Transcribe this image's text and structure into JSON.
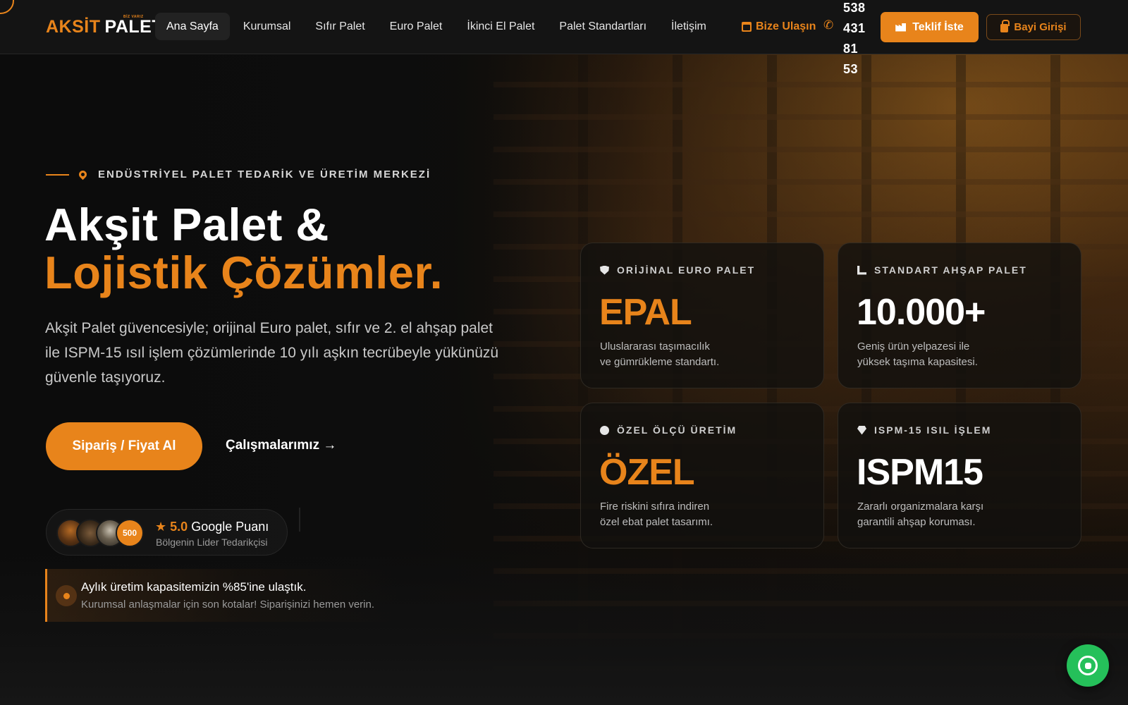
{
  "nav": {
    "logo_primary": "AKSİT",
    "logo_secondary": "PALET",
    "logo_tagline": "BİZ VARIZ",
    "links": [
      {
        "label": "Ana Sayfa",
        "active": true
      },
      {
        "label": "Kurumsal",
        "active": false
      },
      {
        "label": "Sıfır Palet",
        "active": false
      },
      {
        "label": "Euro Palet",
        "active": false
      },
      {
        "label": "İkinci El Palet",
        "active": false
      },
      {
        "label": "Palet Standartları",
        "active": false
      },
      {
        "label": "İletişim",
        "active": false
      }
    ],
    "contact_label": "Bize Ulaşın",
    "phone_lines": [
      "538",
      "431",
      "81",
      "53"
    ],
    "quote_button": "Teklif İste",
    "dealer_button": "Bayi Girişi"
  },
  "hero": {
    "eyebrow": "ENDÜSTRİYEL PALET TEDARİK VE ÜRETİM MERKEZİ",
    "headline_line1": "Akşit Palet &",
    "headline_line2": "Lojistik Çözümler.",
    "lead": "Akşit Palet güvencesiyle; orijinal Euro palet, sıfır ve 2. el ahşap palet ile ISPM-15 ısıl işlem çözümlerinde 10 yılı aşkın tecrübeyle yükünüzü güvenle taşıyoruz.",
    "primary_cta": "Sipariş / Fiyat Al",
    "secondary_cta": "Çalışmalarımız →",
    "rating": {
      "avatar_badge": "500",
      "star": "★",
      "score": "5.0",
      "label": "Google Puanı",
      "sub": "Bölgenin Lider Tedarikçisi"
    },
    "notice": {
      "title": "Aylık üretim kapasitemizin %85'ine ulaştık.",
      "sub": "Kurumsal anlaşmalar için son kotalar! Siparişinizi hemen verin."
    }
  },
  "cards": [
    {
      "icon": "shield-icon",
      "label": "ORİJİNAL EURO PALET",
      "value": "EPAL",
      "value_color": "#e8841b",
      "desc_line1": "Uluslararası taşımacılık",
      "desc_line2": "ve gümrükleme standartı."
    },
    {
      "icon": "chart-icon",
      "label": "STANDART AHŞAP PALET",
      "value": "10.000+",
      "value_color": "#ffffff",
      "desc_line1": "Geniş ürün yelpazesi ile",
      "desc_line2": "yüksek taşıma kapasitesi."
    },
    {
      "icon": "palette-icon",
      "label": "ÖZEL ÖLÇÜ ÜRETİM",
      "value": "ÖZEL",
      "value_color": "#e8841b",
      "desc_line1": "Fire riskini sıfıra indiren",
      "desc_line2": "özel ebat palet tasarımı."
    },
    {
      "icon": "gem-icon",
      "label": "ISPM-15 ISIL İŞLEM",
      "value": "ISPM15",
      "value_color": "#ffffff",
      "desc_line1": "Zararlı organizmalara karşı",
      "desc_line2": "garantili ahşap koruması."
    }
  ],
  "colors": {
    "accent": "#e8841b",
    "background": "#0b0b0b",
    "whatsapp": "#25c05a"
  }
}
